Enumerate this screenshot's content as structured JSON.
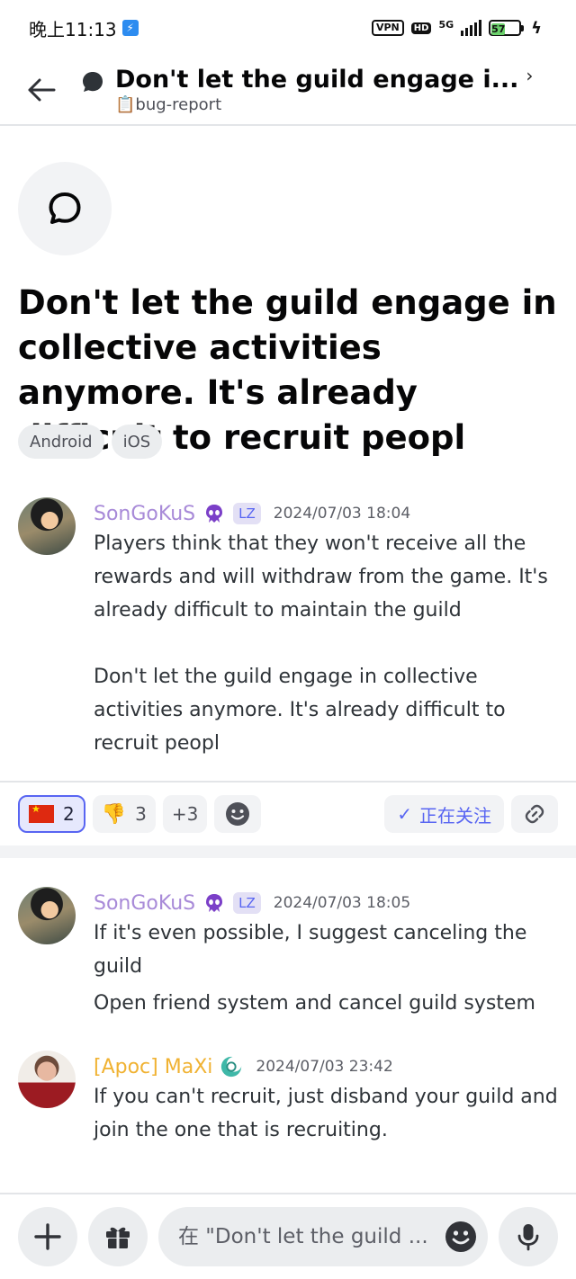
{
  "status_bar": {
    "time": "晚上11:13",
    "vpn": "VPN",
    "hd": "HD",
    "network": "5G",
    "battery": "57"
  },
  "header": {
    "title": "Don't let the guild engage i...",
    "channel": "📋bug-report"
  },
  "thread": {
    "title": "Don't let the guild engage in collective activities anymore. It's already difficult to recruit peopl",
    "tags": [
      "Android",
      "iOS"
    ]
  },
  "messages": [
    {
      "author": "SonGoKuS",
      "tag": "LZ",
      "time": "2024/07/03 18:04",
      "paragraphs": [
        "Players think that they won't receive all the rewards and will withdraw from the game. It's already difficult to maintain the guild",
        "Don't let the guild engage in collective activities anymore. It's already difficult to recruit peopl"
      ]
    },
    {
      "author": "SonGoKuS",
      "tag": "LZ",
      "time": "2024/07/03 18:05",
      "paragraphs": [
        "If it's even possible, I suggest canceling the guild",
        "Open friend system and cancel guild system"
      ]
    },
    {
      "author": "[Apoc] MaXi",
      "time": "2024/07/03 23:42",
      "paragraphs": [
        "If you can't recruit, just disband your guild and join the one that is recruiting."
      ]
    }
  ],
  "reactions": {
    "flag_count": "2",
    "thumbs_down_count": "3",
    "more": "+3",
    "follow_label": "正在关注"
  },
  "composer": {
    "placeholder": "在 \"Don't let the guild ..."
  },
  "colors": {
    "accent": "#5865f2",
    "author_purple": "#a88ad8",
    "author_gold": "#f0b232"
  }
}
